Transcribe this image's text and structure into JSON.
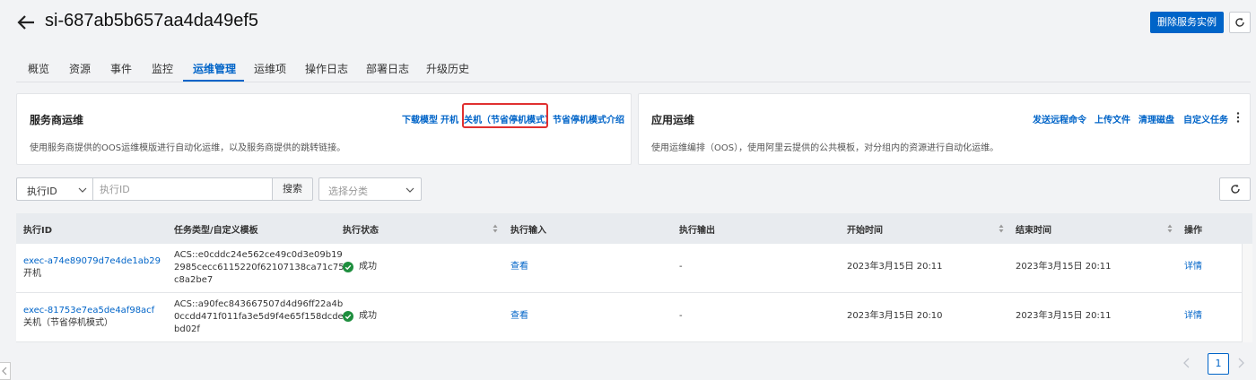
{
  "header": {
    "title": "si-687ab5b657aa4da49ef5",
    "delete_button": "删除服务实例"
  },
  "tabs": [
    {
      "label": "概览"
    },
    {
      "label": "资源"
    },
    {
      "label": "事件"
    },
    {
      "label": "监控"
    },
    {
      "label": "运维管理",
      "active": true
    },
    {
      "label": "运维项"
    },
    {
      "label": "操作日志"
    },
    {
      "label": "部署日志"
    },
    {
      "label": "升级历史"
    }
  ],
  "provider_ops": {
    "title": "服务商运维",
    "description": "使用服务商提供的OOS运维模版进行自动化运维，以及服务商提供的跳转链接。",
    "links": [
      "下载模型",
      "开机",
      "关机（节省停机模式）",
      "节省停机模式介绍"
    ]
  },
  "app_ops": {
    "title": "应用运维",
    "description": "使用运维编排（OOS），使用阿里云提供的公共模板，对分组内的资源进行自动化运维。",
    "links": [
      "发送远程命令",
      "上传文件",
      "清理磁盘",
      "自定义任务"
    ]
  },
  "filter": {
    "field_select": "执行ID",
    "input_placeholder": "执行ID",
    "search_button": "搜索",
    "category_placeholder": "选择分类"
  },
  "table": {
    "columns": [
      "执行ID",
      "任务类型/自定义模板",
      "执行状态",
      "执行输入",
      "执行输出",
      "开始时间",
      "结束时间",
      "操作"
    ],
    "rows": [
      {
        "id": "exec-a74e89079d7e4de1ab29",
        "task_name": "开机",
        "template_l1": "ACS::e0cddc24e562ce49c0d3e09b19",
        "template_l2": "2985cecc6115220f62107138ca71c75",
        "template_l3": "c8a2be7",
        "status": "成功",
        "input": "查看",
        "output": "-",
        "start": "2023年3月15日 20:11",
        "end": "2023年3月15日 20:11",
        "action": "详情"
      },
      {
        "id": "exec-81753e7ea5de4af98acf",
        "task_name": "关机（节省停机模式）",
        "template_l1": "ACS::a90fec843667507d4d96ff22a4b",
        "template_l2": "0ccdd471f011fa3e5d9f4e65f158dcde",
        "template_l3": "bd02f",
        "status": "成功",
        "input": "查看",
        "output": "-",
        "start": "2023年3月15日 20:10",
        "end": "2023年3月15日 20:11",
        "action": "详情"
      }
    ]
  },
  "pagination": {
    "current_page": "1"
  },
  "colors": {
    "primary": "#0064c8",
    "success": "#1e8e3e",
    "highlight": "#e03030"
  }
}
